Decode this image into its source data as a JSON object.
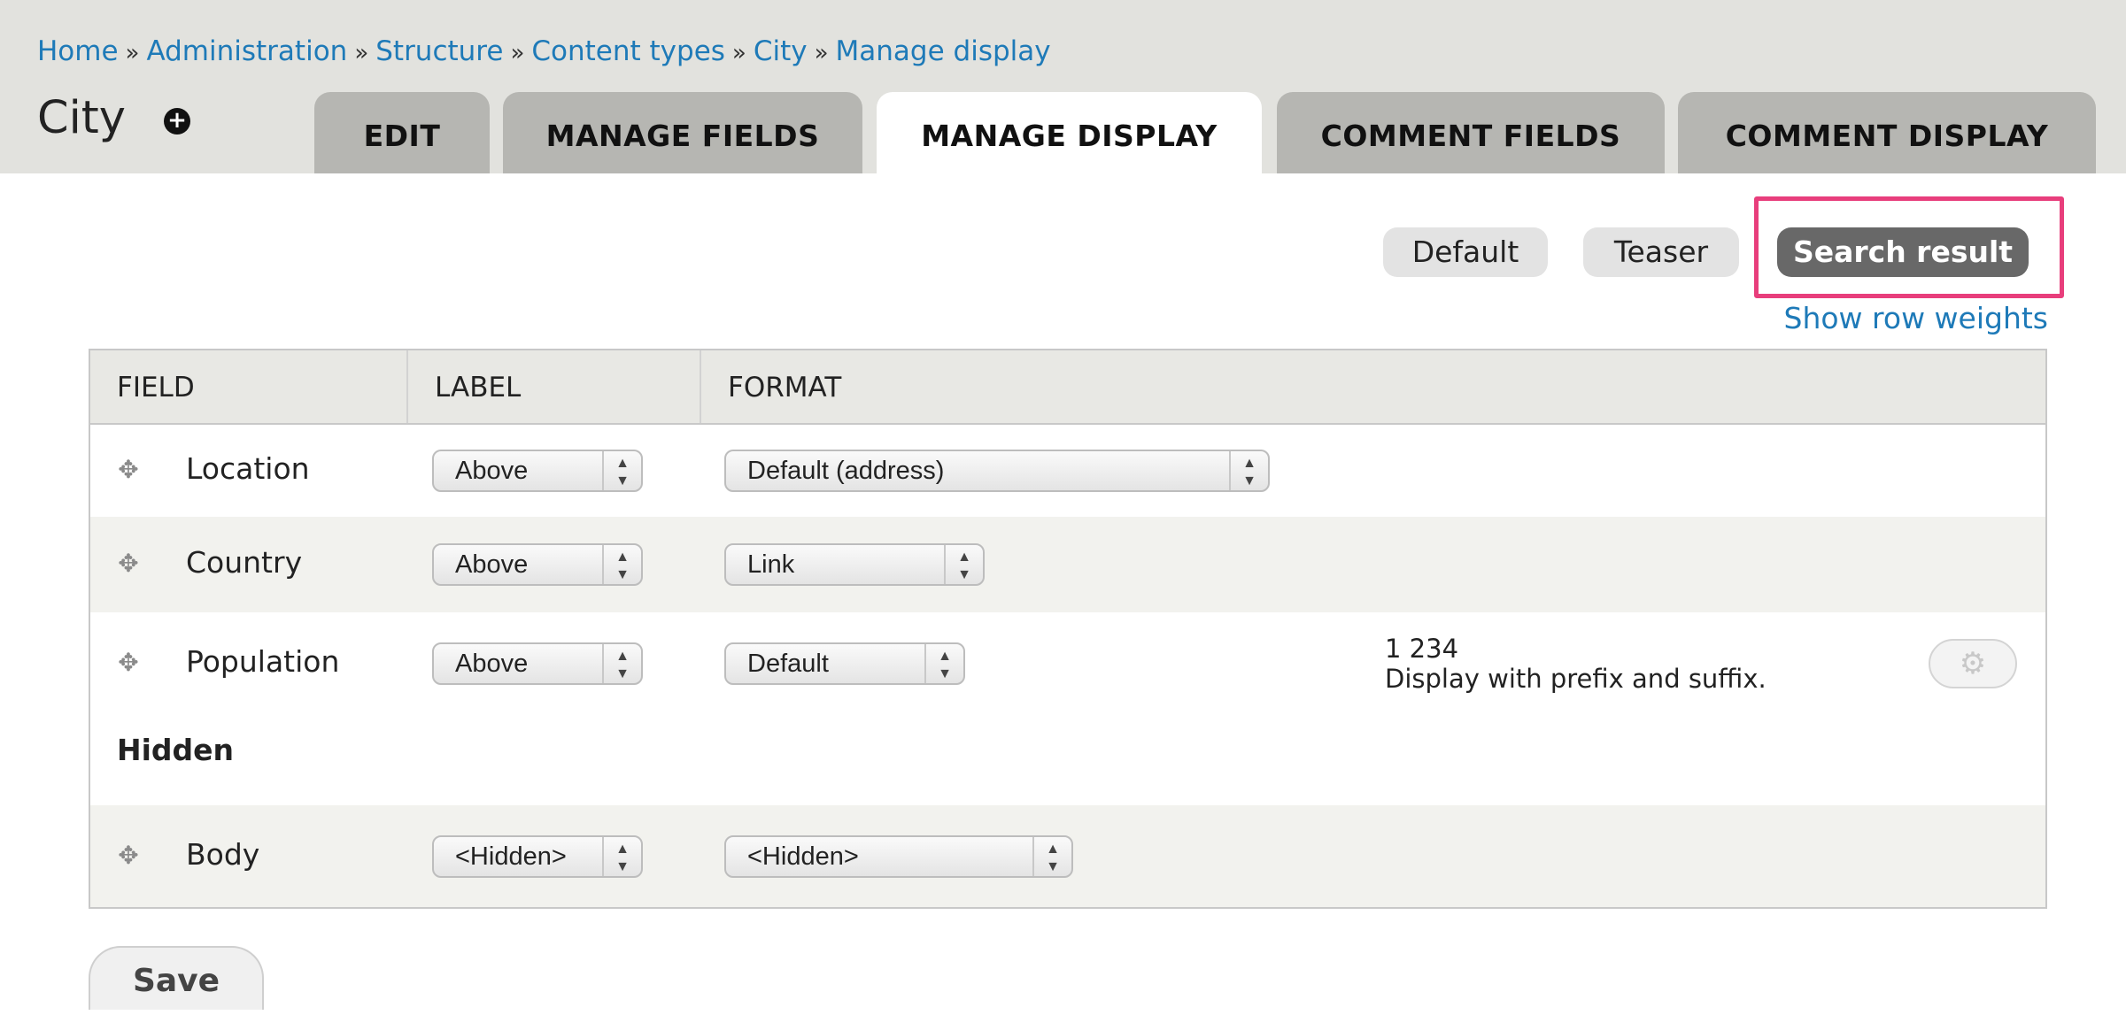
{
  "breadcrumb": {
    "items": [
      "Home",
      "Administration",
      "Structure",
      "Content types",
      "City",
      "Manage display"
    ],
    "separator": "»"
  },
  "page": {
    "title": "City",
    "add_icon": "plus-circle-icon"
  },
  "tabs": [
    {
      "label": "EDIT",
      "active": false
    },
    {
      "label": "MANAGE FIELDS",
      "active": false
    },
    {
      "label": "MANAGE DISPLAY",
      "active": true
    },
    {
      "label": "COMMENT FIELDS",
      "active": false
    },
    {
      "label": "COMMENT DISPLAY",
      "active": false
    }
  ],
  "view_modes": [
    {
      "label": "Default",
      "active": false
    },
    {
      "label": "Teaser",
      "active": false
    },
    {
      "label": "Search result",
      "active": true
    }
  ],
  "highlight_color": "#e83e7c",
  "show_row_weights": "Show row weights",
  "table": {
    "headers": [
      "FIELD",
      "LABEL",
      "FORMAT"
    ],
    "rows": [
      {
        "field": "Location",
        "label": "Above",
        "format": "Default (address)"
      },
      {
        "field": "Country",
        "label": "Above",
        "format": "Link"
      },
      {
        "field": "Population",
        "label": "Above",
        "format": "Default",
        "summary_value": "1 234",
        "summary_text": "Display with prefix and suffix.",
        "settings_icon": "gear-icon"
      }
    ],
    "hidden_heading": "Hidden",
    "hidden_rows": [
      {
        "field": "Body",
        "label": "<Hidden>",
        "format": "<Hidden>"
      }
    ]
  },
  "save_label": "Save",
  "colors": {
    "link": "#1e7ab8",
    "header_bg": "#e2e2de",
    "active_pill": "#686868"
  }
}
